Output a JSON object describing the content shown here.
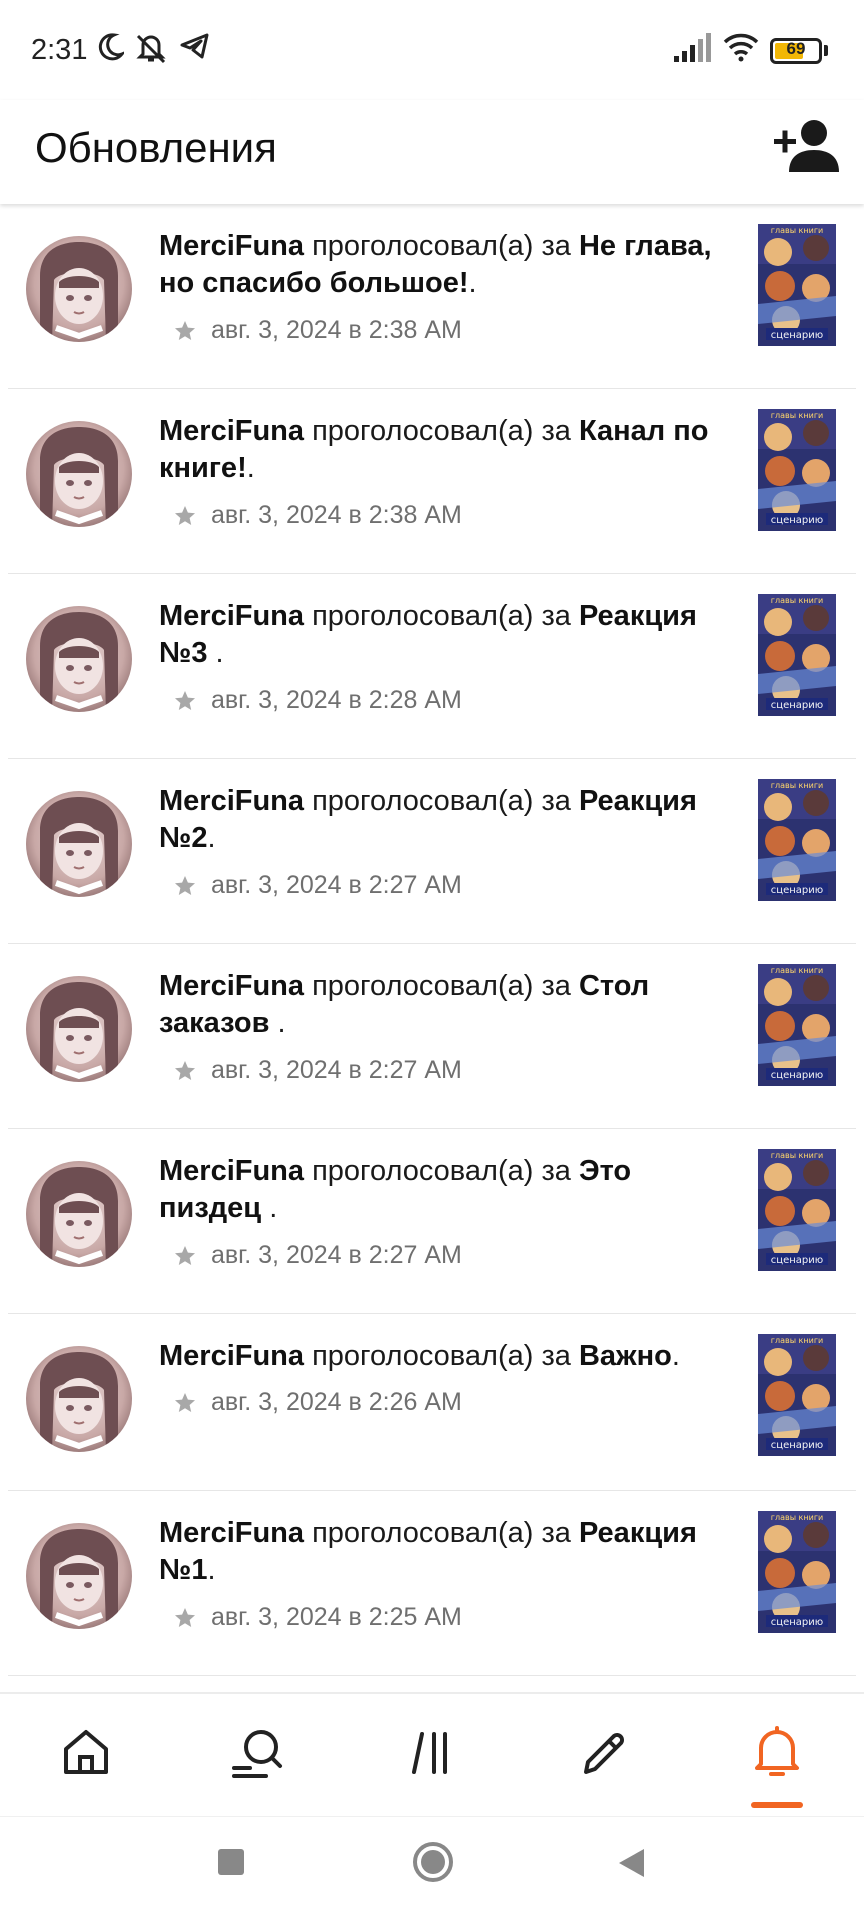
{
  "status_bar": {
    "time": "2:31",
    "battery": "69",
    "battery_level": 0.69,
    "icons": [
      "moon-icon",
      "notifications-off-icon",
      "telegram-icon",
      "signal-icon",
      "wifi-icon",
      "battery-icon"
    ]
  },
  "header": {
    "title": "Обновления",
    "action_icon": "add-user-icon"
  },
  "colors": {
    "accent": "#f16522",
    "meta_text": "#6f6f6f",
    "star": "#a8a8a8"
  },
  "feed": [
    {
      "user": "MerciFuna",
      "action": " проголосовал(а) за ",
      "title": "Не глава, но спасибо большое!",
      "suffix": ".",
      "date": "авг. 3, 2024 в 2:38 AM"
    },
    {
      "user": "MerciFuna",
      "action": " проголосовал(а) за ",
      "title": "Канал по книге!",
      "suffix": ".",
      "date": "авг. 3, 2024 в 2:38 AM"
    },
    {
      "user": "MerciFuna",
      "action": " проголосовал(а) за ",
      "title": "Реакция №3 ",
      "suffix": ".",
      "date": "авг. 3, 2024 в 2:28 AM"
    },
    {
      "user": "MerciFuna",
      "action": " проголосовал(а) за ",
      "title": "Реакция №2",
      "suffix": ".",
      "date": "авг. 3, 2024 в 2:27 AM"
    },
    {
      "user": "MerciFuna",
      "action": " проголосовал(а) за ",
      "title": "Стол заказов ",
      "suffix": ".",
      "date": "авг. 3, 2024 в 2:27 AM"
    },
    {
      "user": "MerciFuna",
      "action": " проголосовал(а) за ",
      "title": "Это пиздец ",
      "suffix": ".",
      "date": "авг. 3, 2024 в 2:27 AM"
    },
    {
      "user": "MerciFuna",
      "action": " проголосовал(а) за ",
      "title": "Важно",
      "suffix": ".",
      "date": "авг. 3, 2024 в 2:26 AM"
    },
    {
      "user": "MerciFuna",
      "action": " проголосовал(а) за ",
      "title": "Реакция №1",
      "suffix": ".",
      "date": "авг. 3, 2024 в 2:25 AM"
    }
  ],
  "bottom_nav": {
    "items": [
      "home-icon",
      "search-icon",
      "library-icon",
      "write-icon",
      "notifications-icon"
    ],
    "active": "notifications-icon"
  },
  "system_nav": [
    "recents-button",
    "home-button",
    "back-button"
  ]
}
